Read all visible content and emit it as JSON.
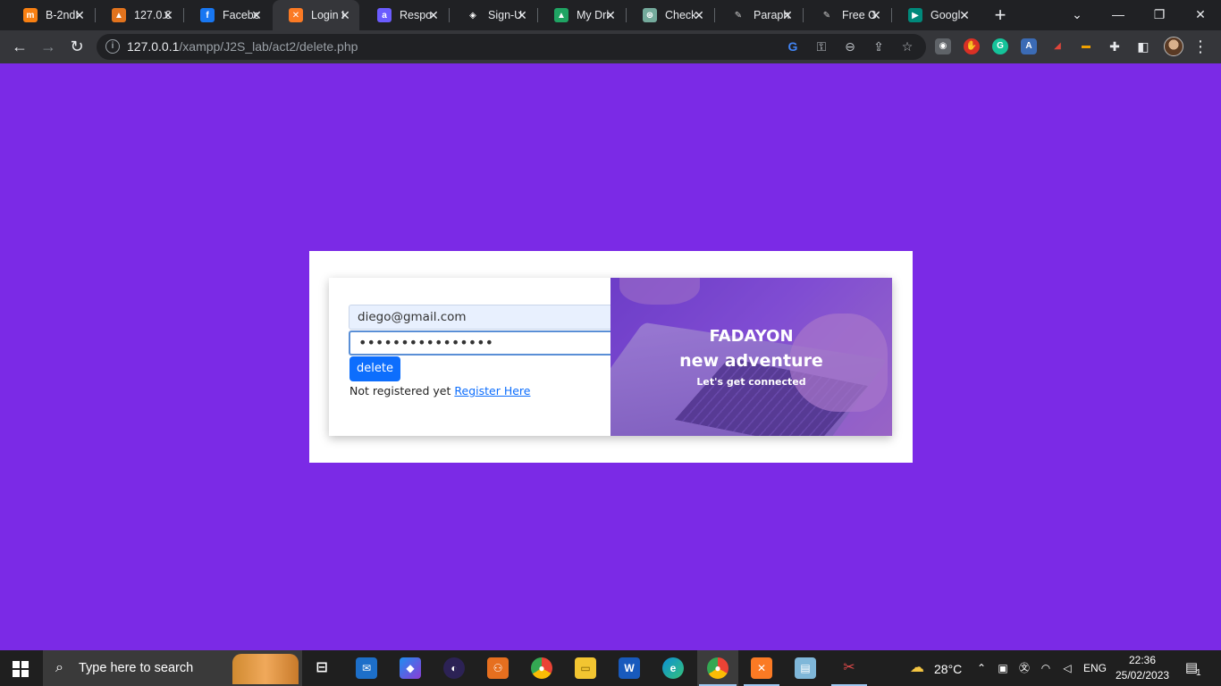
{
  "browser": {
    "tabs": [
      {
        "title": "B-2ndI",
        "icon": "moodle-icon",
        "color": "#f98012",
        "glyph": "m"
      },
      {
        "title": "127.0.0",
        "icon": "xampp-cone-icon",
        "color": "#e2731d",
        "glyph": "▲"
      },
      {
        "title": "Facebo",
        "icon": "facebook-icon",
        "color": "#1877f2",
        "glyph": "f"
      },
      {
        "title": "Login I",
        "icon": "xampp-icon",
        "color": "#fb7a24",
        "glyph": "✕"
      },
      {
        "title": "Respo",
        "icon": "app-icon",
        "color": "#6b5cff",
        "glyph": "a"
      },
      {
        "title": "Sign-U",
        "icon": "codepen-icon",
        "color": "#ffffff",
        "glyph": "◈"
      },
      {
        "title": "My Dri",
        "icon": "google-drive-icon",
        "color": "#1fa463",
        "glyph": "▲"
      },
      {
        "title": "Check",
        "icon": "chatgpt-icon",
        "color": "#74aa9c",
        "glyph": "⊛"
      },
      {
        "title": "Paraph",
        "icon": "quill-icon",
        "color": "#cccccc",
        "glyph": "✎"
      },
      {
        "title": "Free G",
        "icon": "quill-icon",
        "color": "#cccccc",
        "glyph": "✎"
      },
      {
        "title": "Googl",
        "icon": "google-meet-icon",
        "color": "#00897b",
        "glyph": "▶"
      }
    ],
    "active_tab_index": 3,
    "address": {
      "host": "127.0.0.1",
      "path": "/xampp/J2S_lab/act2/delete.php"
    }
  },
  "page": {
    "email_value": "diego@gmail.com",
    "password_value": "••••••••••••••••",
    "delete_label": "delete",
    "not_registered_text": "Not registered yet ",
    "register_link": "Register Here",
    "hero_title": "FADAYON",
    "hero_subtitle": "new adventure",
    "hero_tagline": "Let's get connected",
    "colors": {
      "background": "#7b2ae6",
      "button": "#0d6efd"
    }
  },
  "taskbar": {
    "search_placeholder": "Type here to search",
    "weather": "28°C",
    "language": "ENG",
    "time": "22:36",
    "date": "25/02/2023",
    "notification_count": "1"
  }
}
